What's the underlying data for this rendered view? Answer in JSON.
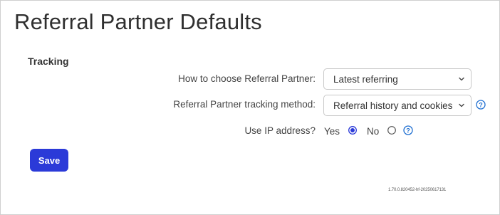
{
  "page": {
    "title": "Referral Partner Defaults"
  },
  "tracking": {
    "section_title": "Tracking",
    "choose_partner": {
      "label": "How to choose Referral Partner:",
      "value": "Latest referring"
    },
    "tracking_method": {
      "label": "Referral Partner tracking method:",
      "value": "Referral history and cookies"
    },
    "use_ip": {
      "label": "Use IP address?",
      "options": [
        {
          "label": "Yes",
          "selected": true
        },
        {
          "label": "No",
          "selected": false
        }
      ]
    }
  },
  "actions": {
    "save_label": "Save"
  },
  "footer": {
    "version": "1.70.0.820452-hf-20250617131"
  },
  "colors": {
    "accent": "#2b3ad8",
    "help_icon": "#1f6fd1",
    "border": "#c8c8c8"
  }
}
